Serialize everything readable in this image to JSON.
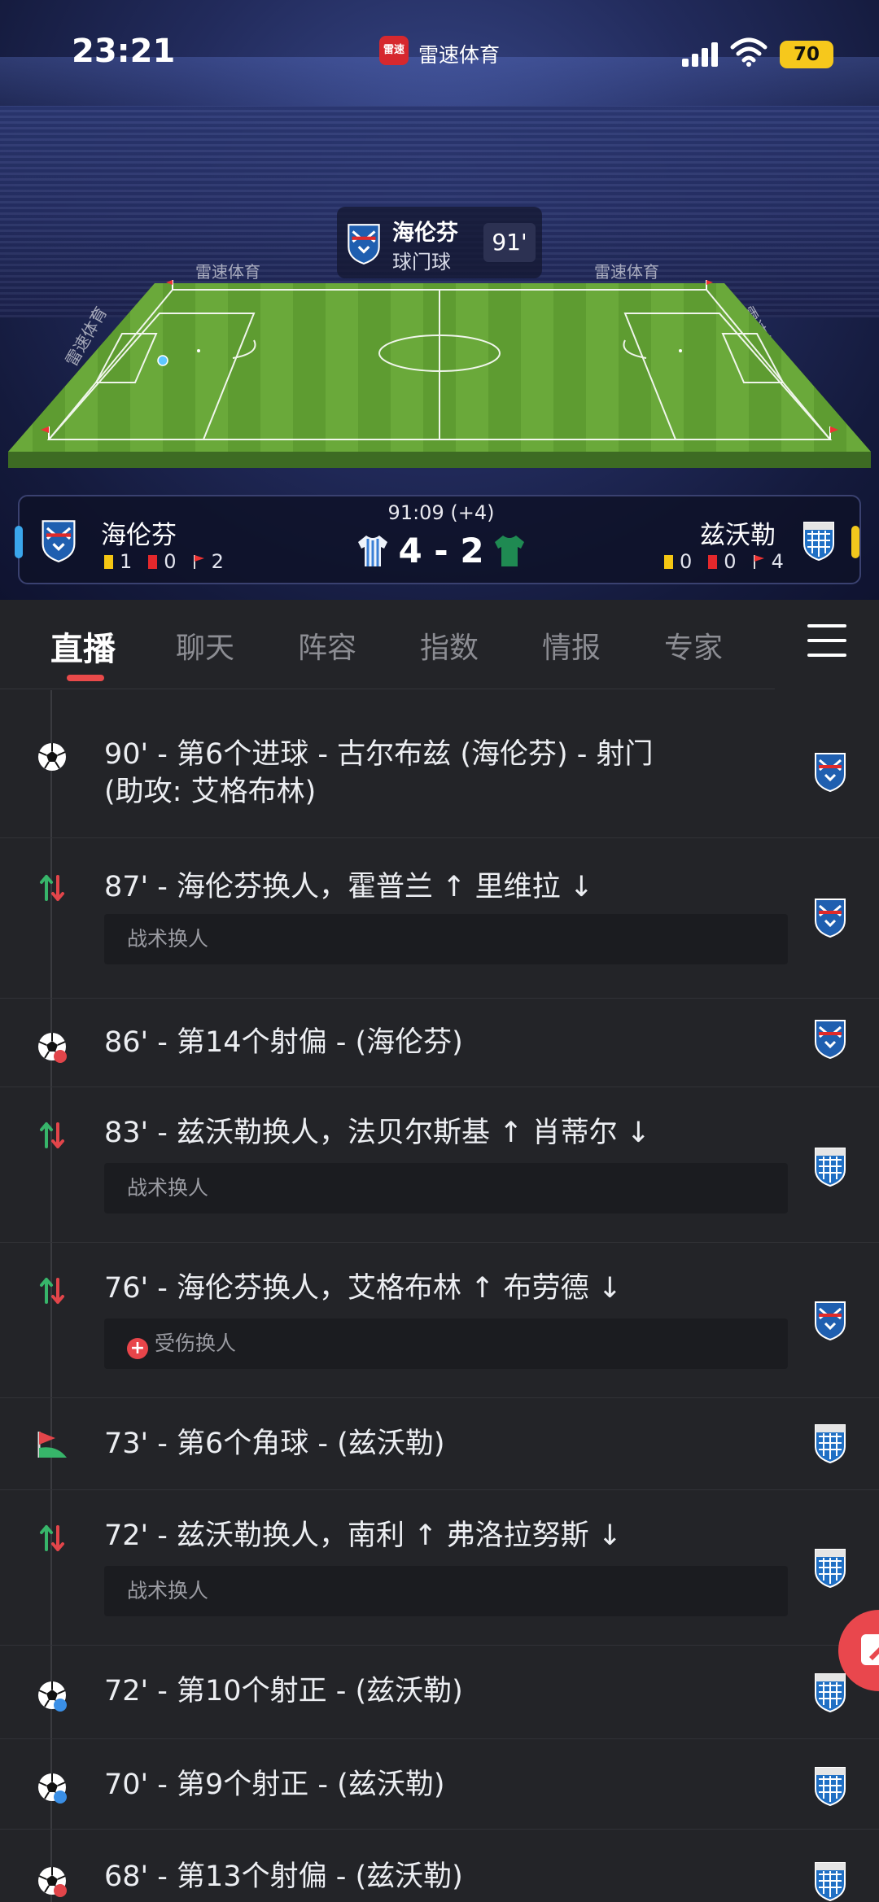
{
  "status_bar": {
    "time": "23:21",
    "app_badge": "雷速",
    "app_name": "雷速体育",
    "battery": "70"
  },
  "live_event": {
    "team": "海伦芬",
    "type": "球门球",
    "minute": "91'"
  },
  "watermarks": [
    "雷速体育",
    "雷速体育",
    "雷速体育",
    "雷速体育"
  ],
  "scoreboard": {
    "clock": "91:09 (+4)",
    "score": "4 - 2",
    "home": {
      "name": "海伦芬",
      "yellow": "1",
      "red": "0",
      "corners": "2",
      "color": "#3aa6ec"
    },
    "away": {
      "name": "兹沃勒",
      "yellow": "0",
      "red": "0",
      "corners": "4",
      "color": "#f2c81c"
    }
  },
  "tabs": [
    "直播",
    "聊天",
    "阵容",
    "指数",
    "情报",
    "专家"
  ],
  "active_tab": "直播",
  "events": [
    {
      "icon": "goal-icon",
      "line1": "90' - 第6个进球 - 古尔布兹 (海伦芬) - 射门",
      "line2": "(助攻: 艾格布林)",
      "team": "home"
    },
    {
      "icon": "substitution-icon",
      "line1": "87' - 海伦芬换人，霍普兰 ↑ 里维拉 ↓",
      "sub": "战术换人",
      "team": "home"
    },
    {
      "icon": "shot-off-target-icon",
      "line1": "86' - 第14个射偏 - (海伦芬)",
      "team": "home"
    },
    {
      "icon": "substitution-icon",
      "line1": "83' - 兹沃勒换人，法贝尔斯基 ↑ 肖蒂尔 ↓",
      "sub": "战术换人",
      "team": "away"
    },
    {
      "icon": "substitution-icon",
      "line1": "76' - 海伦芬换人，艾格布林 ↑ 布劳德 ↓",
      "sub": "受伤换人",
      "team": "home"
    },
    {
      "icon": "corner-kick-icon",
      "line1": "73' - 第6个角球 - (兹沃勒)",
      "team": "away"
    },
    {
      "icon": "substitution-icon",
      "line1": "72' - 兹沃勒换人，南利 ↑ 弗洛拉努斯 ↓",
      "sub": "战术换人",
      "team": "away"
    },
    {
      "icon": "shot-on-target-icon",
      "line1": "72' - 第10个射正 - (兹沃勒)",
      "team": "away"
    },
    {
      "icon": "shot-on-target-icon",
      "line1": "70' - 第9个射正 - (兹沃勒)",
      "team": "away"
    },
    {
      "icon": "shot-off-target-icon",
      "line1": "68' - 第13个射偏 - (兹沃勒)",
      "team": "away"
    }
  ]
}
